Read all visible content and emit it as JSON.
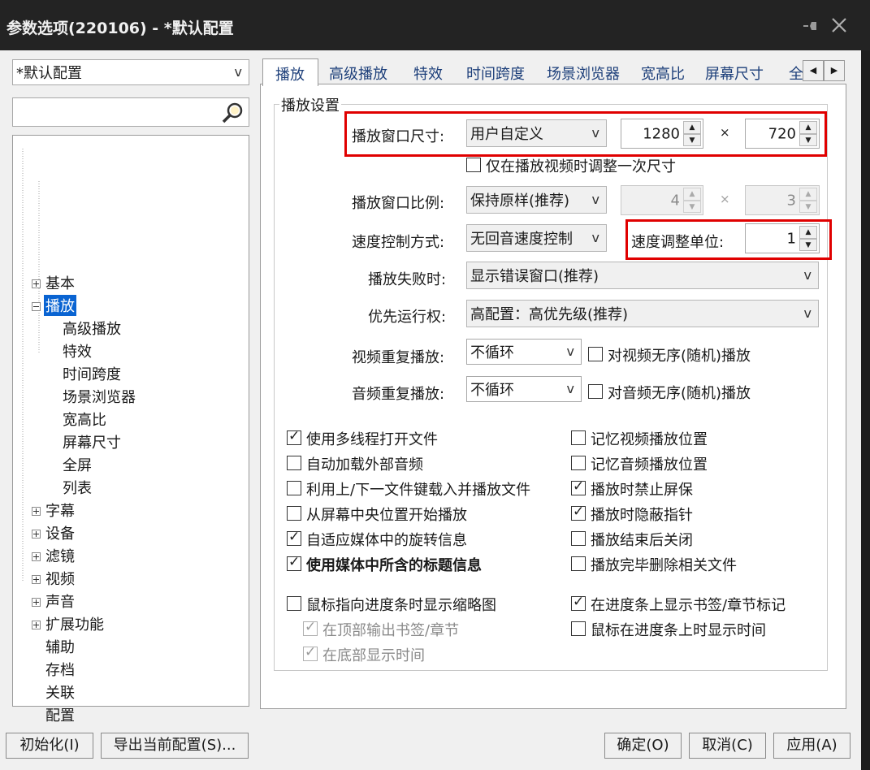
{
  "window": {
    "title": "参数选项(220106) - *默认配置",
    "pin_icon": "pin-icon",
    "close_icon": "close-icon"
  },
  "profile": {
    "selected": "*默认配置",
    "arrow": "v"
  },
  "search": {
    "value": "",
    "icon": "search-icon"
  },
  "tree": {
    "items": [
      {
        "label": "基本",
        "expander": "plus"
      },
      {
        "label": "播放",
        "expander": "minus",
        "selected": true
      },
      {
        "label": "高级播放"
      },
      {
        "label": "特效"
      },
      {
        "label": "时间跨度"
      },
      {
        "label": "场景浏览器"
      },
      {
        "label": "宽高比"
      },
      {
        "label": "屏幕尺寸"
      },
      {
        "label": "全屏"
      },
      {
        "label": "列表"
      },
      {
        "label": "字幕",
        "expander": "plus"
      },
      {
        "label": "设备",
        "expander": "plus"
      },
      {
        "label": "滤镜",
        "expander": "plus"
      },
      {
        "label": "视频",
        "expander": "plus"
      },
      {
        "label": "声音",
        "expander": "plus"
      },
      {
        "label": "扩展功能",
        "expander": "plus"
      },
      {
        "label": "辅助"
      },
      {
        "label": "存档"
      },
      {
        "label": "关联"
      },
      {
        "label": "配置"
      }
    ]
  },
  "tabs": [
    "播放",
    "高级播放",
    "特效",
    "时间跨度",
    "场景浏览器",
    "宽高比",
    "屏幕尺寸",
    "全"
  ],
  "tab_nav": {
    "left": "◀",
    "right": "▶"
  },
  "group": {
    "title": "播放设置",
    "window_size": {
      "label": "播放窗口尺寸:",
      "mode": "用户自定义",
      "width": "1280",
      "height": "720",
      "times": "×"
    },
    "resize_once": {
      "label": "仅在播放视频时调整一次尺寸",
      "checked": false
    },
    "ratio": {
      "label": "播放窗口比例:",
      "mode": "保持原样(推荐)",
      "a": "4",
      "b": "3",
      "times": "×"
    },
    "speed": {
      "label": "速度控制方式:",
      "mode": "无回音速度控制",
      "unit_label": "速度调整单位:",
      "unit": "1"
    },
    "fail": {
      "label": "播放失败时:",
      "mode": "显示错误窗口(推荐)"
    },
    "priority": {
      "label": "优先运行权:",
      "mode": "高配置：高优先级(推荐)"
    },
    "video_repeat": {
      "label": "视频重复播放:",
      "mode": "不循环",
      "random_label": "对视频无序(随机)播放",
      "random_checked": false
    },
    "audio_repeat": {
      "label": "音频重复播放:",
      "mode": "不循环",
      "random_label": "对音频无序(随机)播放",
      "random_checked": false
    },
    "arrow": "v",
    "spin_up": "▲",
    "spin_down": "▼"
  },
  "options_left": [
    {
      "label": "使用多线程打开文件",
      "checked": true
    },
    {
      "label": "自动加载外部音频",
      "checked": false
    },
    {
      "label": "利用上/下一文件键载入并播放文件",
      "checked": false
    },
    {
      "label": "从屏幕中央位置开始播放",
      "checked": false
    },
    {
      "label": "自适应媒体中的旋转信息",
      "checked": true
    },
    {
      "label": "使用媒体中所含的标题信息",
      "checked": true,
      "bold": true
    }
  ],
  "options_right": [
    {
      "label": "记忆视频播放位置",
      "checked": false
    },
    {
      "label": "记忆音频播放位置",
      "checked": false
    },
    {
      "label": "播放时禁止屏保",
      "checked": true
    },
    {
      "label": "播放时隐蔽指针",
      "checked": true
    },
    {
      "label": "播放结束后关闭",
      "checked": false
    },
    {
      "label": "播放完毕删除相关文件",
      "checked": false
    }
  ],
  "seek": {
    "thumb": {
      "label": "鼠标指向进度条时显示缩略图",
      "checked": false
    },
    "top_bookmarks": {
      "label": "在顶部输出书签/章节",
      "checked": true,
      "disabled": true
    },
    "bottom_time": {
      "label": "在底部显示时间",
      "checked": true,
      "disabled": true
    },
    "show_bookmarks": {
      "label": "在进度条上显示书签/章节标记",
      "checked": true
    },
    "show_time": {
      "label": "鼠标在进度条上时显示时间",
      "checked": false
    }
  },
  "buttons": {
    "init": "初始化(I)",
    "export": "导出当前配置(S)...",
    "ok": "确定(O)",
    "cancel": "取消(C)",
    "apply": "应用(A)"
  }
}
